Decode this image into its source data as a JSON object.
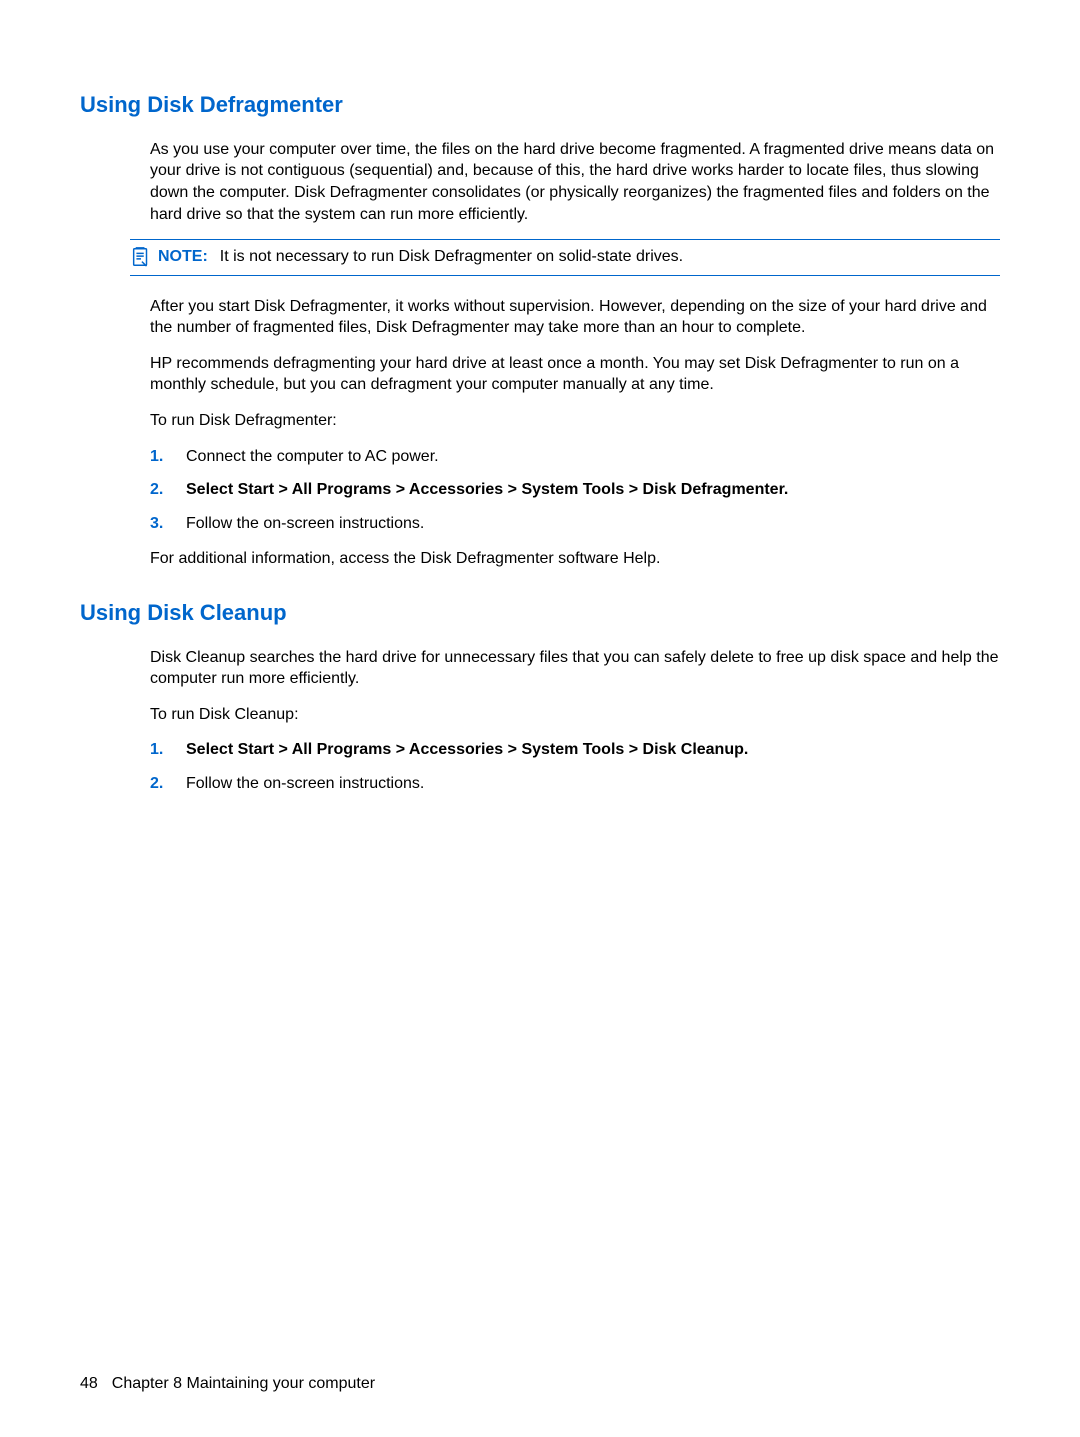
{
  "section1": {
    "heading": "Using Disk Defragmenter",
    "p1": "As you use your computer over time, the files on the hard drive become fragmented. A fragmented drive means data on your drive is not contiguous (sequential) and, because of this, the hard drive works harder to locate files, thus slowing down the computer. Disk Defragmenter consolidates (or physically reorganizes) the fragmented files and folders on the hard drive so that the system can run more efficiently.",
    "note_label": "NOTE:",
    "note_text": "It is not necessary to run Disk Defragmenter on solid-state drives.",
    "p2": "After you start Disk Defragmenter, it works without supervision. However, depending on the size of your hard drive and the number of fragmented files, Disk Defragmenter may take more than an hour to complete.",
    "p3": "HP recommends defragmenting your hard drive at least once a month. You may set Disk Defragmenter to run on a monthly schedule, but you can defragment your computer manually at any time.",
    "p4": "To run Disk Defragmenter:",
    "step1_num": "1.",
    "step1": "Connect the computer to AC power.",
    "step2_num": "2.",
    "step2_prefix": "Select ",
    "step2_bold": "Start > All Programs > Accessories > System Tools > Disk Defragmenter",
    "step2_suffix": ".",
    "step3_num": "3.",
    "step3": "Follow the on-screen instructions.",
    "p5": "For additional information, access the Disk Defragmenter software Help."
  },
  "section2": {
    "heading": "Using Disk Cleanup",
    "p1": "Disk Cleanup searches the hard drive for unnecessary files that you can safely delete to free up disk space and help the computer run more efficiently.",
    "p2": "To run Disk Cleanup:",
    "step1_num": "1.",
    "step1_prefix": "Select ",
    "step1_bold": "Start > All Programs > Accessories > System Tools > Disk Cleanup",
    "step1_suffix": ".",
    "step2_num": "2.",
    "step2": "Follow the on-screen instructions."
  },
  "footer": {
    "page_number": "48",
    "chapter": "Chapter 8   Maintaining your computer"
  }
}
